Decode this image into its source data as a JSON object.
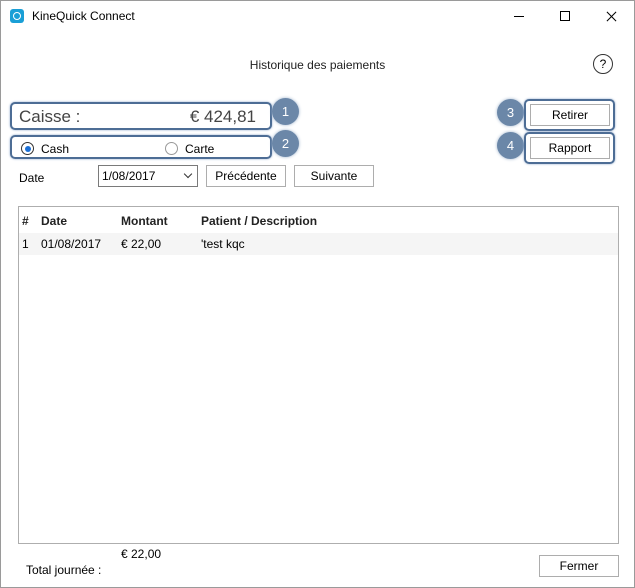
{
  "window": {
    "title": "KineQuick Connect"
  },
  "page": {
    "title": "Historique des paiements",
    "help_label": "?"
  },
  "caisse": {
    "label": "Caisse :",
    "value": "€ 424,81"
  },
  "payment_mode": {
    "options": [
      "Cash",
      "Carte"
    ],
    "selected": "Cash"
  },
  "buttons": {
    "retirer": "Retirer",
    "rapport": "Rapport",
    "precedente": "Précédente",
    "suivante": "Suivante",
    "fermer": "Fermer"
  },
  "annotations": [
    "1",
    "2",
    "3",
    "4"
  ],
  "date_filter": {
    "label": "Date",
    "value": "1/08/2017"
  },
  "table": {
    "columns": [
      "#",
      "Date",
      "Montant",
      "Patient / Description"
    ],
    "rows": [
      [
        "1",
        "01/08/2017",
        "€ 22,00",
        "'test kqc"
      ]
    ]
  },
  "footer": {
    "total_amount": "€ 22,00",
    "total_label": "Total journée :"
  },
  "colors": {
    "highlight": "#4d6d95",
    "badge": "#6b87a8",
    "app_icon": "#1a9fd6"
  }
}
